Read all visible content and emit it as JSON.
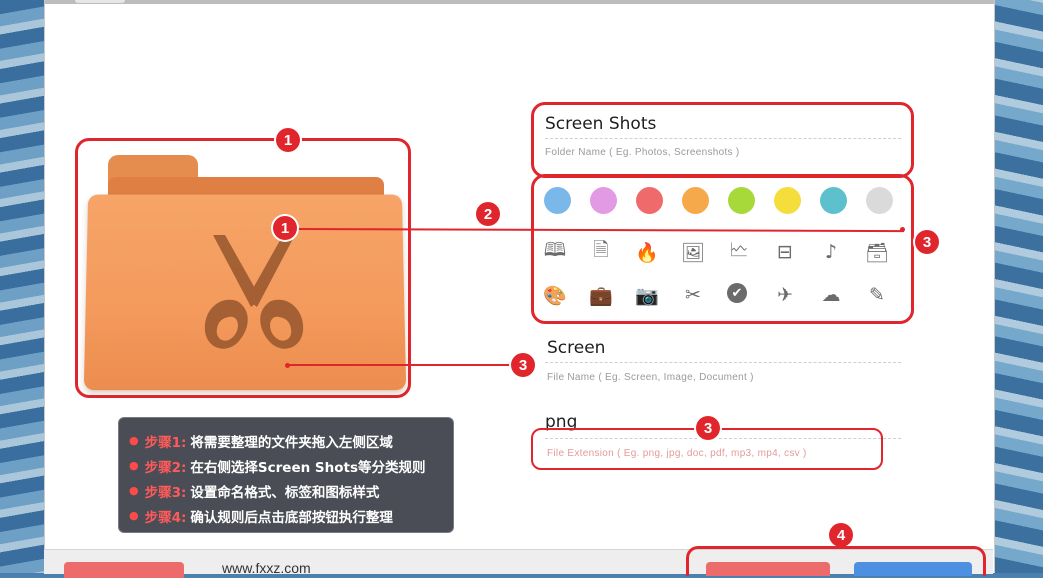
{
  "app": {
    "footer_url": "www.fxxz.com"
  },
  "markers": [
    "1",
    "1",
    "2",
    "3",
    "3",
    "3",
    "4"
  ],
  "folder": {
    "icon": "scissors-folder-icon",
    "color": "#f39a5c"
  },
  "category": {
    "name": "Screen Shots",
    "hint": "Folder Name ( Eg. Photos, Screenshots )"
  },
  "colors": [
    "#7ab8ea",
    "#e39ae5",
    "#ef6b6b",
    "#f5a94a",
    "#a8d93b",
    "#f5dd3b",
    "#5cc1cc",
    "#dadada"
  ],
  "icon_grid": [
    [
      "book-icon",
      "document-icon",
      "flame-icon",
      "picture-icon",
      "presentation-icon",
      "film-icon",
      "music-note-icon",
      "archive-icon"
    ],
    [
      "palette-icon",
      "briefcase-icon",
      "camera-icon",
      "scissors-icon",
      "checkmark-icon",
      "airplane-icon",
      "cloud-icon",
      "pencil-icon"
    ]
  ],
  "naming": {
    "name": "Screen",
    "hint": "File Name ( Eg. Screen, Image, Document )"
  },
  "extension": {
    "name": "png",
    "hint": "File Extension ( Eg. png, jpg, doc, pdf, mp3, mp4, csv )"
  },
  "steps": [
    {
      "label": "步骤1:",
      "text": "将需要整理的文件夹拖入左侧区域"
    },
    {
      "label": "步骤2:",
      "text": "在右侧选择Screen Shots等分类规则"
    },
    {
      "label": "步骤3:",
      "text": "设置命名格式、标签和图标样式"
    },
    {
      "label": "步骤4:",
      "text": "确认规则后点击底部按钮执行整理"
    }
  ]
}
